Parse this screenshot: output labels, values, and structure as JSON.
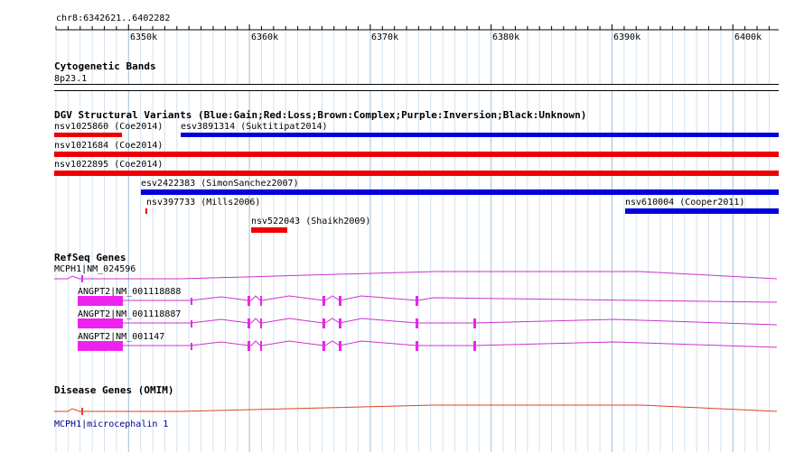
{
  "region": "chr8:6342621..6402282",
  "ruler": {
    "ticks": [
      "6350k",
      "6360k",
      "6370k",
      "6380k",
      "6390k",
      "6400k"
    ]
  },
  "tracks": {
    "cytobands": {
      "title": "Cytogenetic Bands",
      "band": "8p23.1"
    },
    "dgv": {
      "title": "DGV Structural Variants (Blue:Gain;Red:Loss;Brown:Complex;Purple:Inversion;Black:Unknown)",
      "colors": {
        "gain": "#0000dd",
        "loss": "#ee0000"
      },
      "features": [
        {
          "label": "nsv1025860 (Coe2014)",
          "type": "loss"
        },
        {
          "label": "esv3891314 (Suktitipat2014)",
          "type": "gain"
        },
        {
          "label": "nsv1021684 (Coe2014)",
          "type": "loss"
        },
        {
          "label": "nsv1022895 (Coe2014)",
          "type": "loss"
        },
        {
          "label": "esv2422383 (SimonSanchez2007)",
          "type": "gain"
        },
        {
          "label": "nsv397733 (Mills2006)",
          "type": "loss"
        },
        {
          "label": "nsv610004 (Cooper2011)",
          "type": "gain"
        },
        {
          "label": "nsv522043 (Shaikh2009)",
          "type": "loss"
        }
      ]
    },
    "refseq": {
      "title": "RefSeq Genes",
      "color": "#cc33cc",
      "genes": [
        {
          "label": "MCPH1|NM_024596"
        },
        {
          "label": "ANGPT2|NM_001118888"
        },
        {
          "label": "ANGPT2|NM_001118887"
        },
        {
          "label": "ANGPT2|NM_001147"
        }
      ]
    },
    "omim": {
      "title": "Disease Genes (OMIM)",
      "color": "#dd4422",
      "label": "MCPH1|microcephalin 1",
      "label_color": "#000088"
    }
  }
}
